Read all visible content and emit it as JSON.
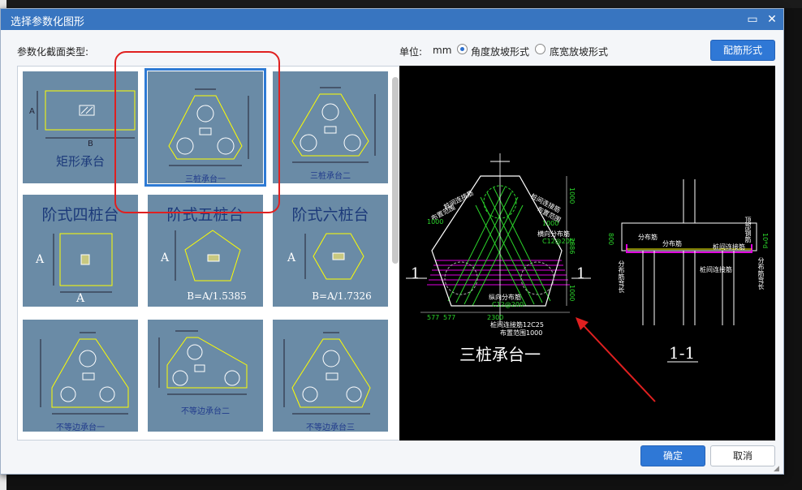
{
  "dialog": {
    "title": "选择参数化图形",
    "minimize_label": "▭",
    "close_label": "✕"
  },
  "section_label": "参数化截面类型:",
  "units": {
    "label": "单位:",
    "value": "mm",
    "option_angle": "角度放坡形式",
    "option_width": "底宽放坡形式",
    "selected": "角度放坡形式"
  },
  "rebar_button": "配筋形式",
  "ok_button": "确定",
  "cancel_button": "取消",
  "thumbnails": [
    {
      "id": "rect",
      "caption": "矩形承台",
      "title": ""
    },
    {
      "id": "tri1",
      "caption": "三桩承台一",
      "title": "",
      "selected": true
    },
    {
      "id": "tri2",
      "caption": "三桩承台二",
      "title": ""
    },
    {
      "id": "step4",
      "caption": "A",
      "title": "阶式四桩台"
    },
    {
      "id": "step5",
      "caption": "B=A/1.5385",
      "title": "阶式五桩台"
    },
    {
      "id": "step6",
      "caption": "B=A/1.7326",
      "title": "阶式六桩台"
    },
    {
      "id": "uneq1",
      "caption": "不等边承台一",
      "title": ""
    },
    {
      "id": "uneq2",
      "caption": "不等边承台二",
      "title": ""
    },
    {
      "id": "uneq3",
      "caption": "不等边承台三",
      "title": ""
    }
  ],
  "preview": {
    "main_title": "三桩承台一",
    "section_title": "1-1",
    "section_mark_left": "1",
    "section_mark_right": "1",
    "labels": {
      "side_rebar_1": "桩间连接筋",
      "side_rebar_1b": "布置范围",
      "side_rebar_1c": "1000",
      "side_rebar_2": "桩间连接筋",
      "side_rebar_2b": "布置范围",
      "side_rebar_2c": "1000",
      "transverse": "横向分布筋",
      "transverse_val": "C12@200",
      "longitudinal": "纵向分布筋",
      "longitudinal_val": "C12@200",
      "bottom_rebar": "桩间连接筋12C25",
      "bottom_range": "布置范围1000",
      "dim_2300": "2300",
      "dim_577a": "577",
      "dim_577b": "577",
      "dim_1000a": "1000",
      "dim_1000b": "1000",
      "dim_2886": "2886",
      "dim_800": "800",
      "sec_dist1": "分布筋",
      "sec_dist2": "分布筋",
      "sec_link": "桩间连接筋",
      "sec_link2": "桩间连接筋",
      "sec_side_left": "分布筋弯长",
      "sec_side_right": "分布筋弯长",
      "sec_top_label": "顶部钢筋",
      "sec_10d": "10*d"
    }
  },
  "colors": {
    "titlebar": "#3875c0",
    "thumb_bg": "#6a8ba6",
    "shape_line": "#ffff00",
    "preview_green": "#2bd52b",
    "preview_magenta": "#e000e0",
    "annotation_red": "#e02020"
  }
}
